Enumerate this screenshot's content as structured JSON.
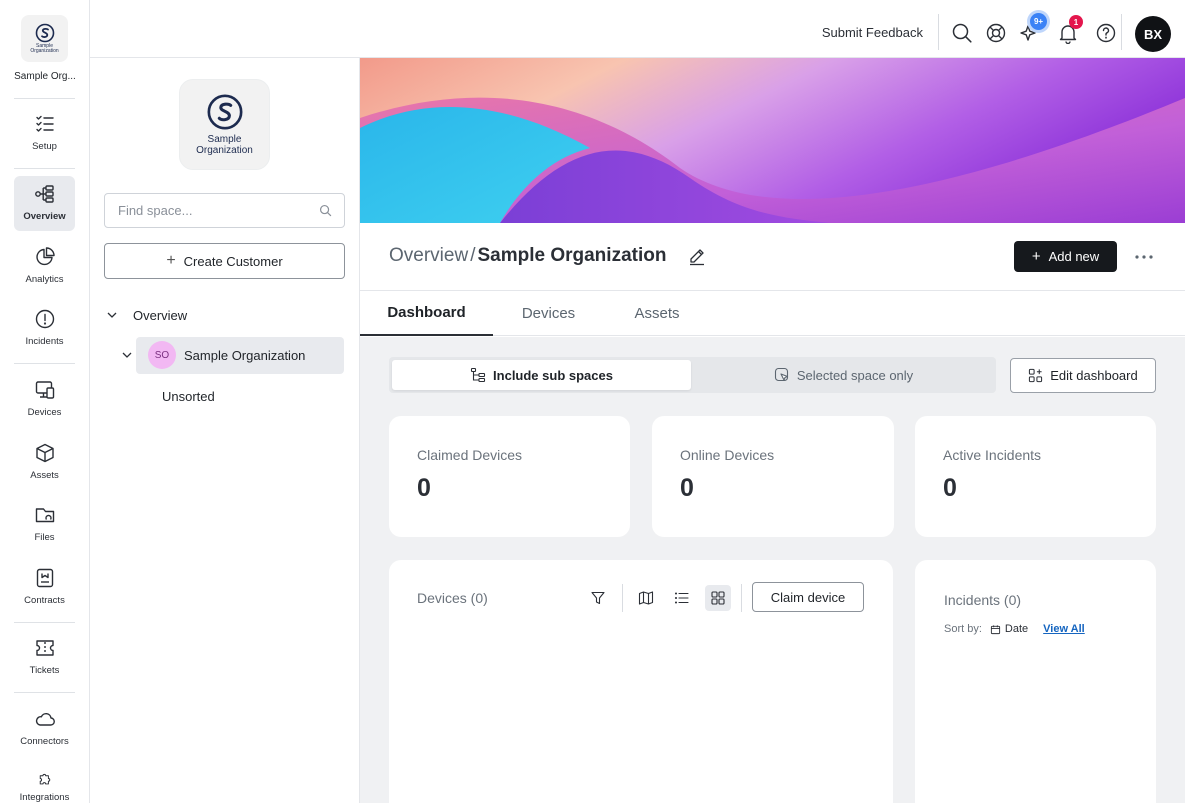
{
  "org": {
    "name_short": "Sample Org...",
    "logo_line1": "Sample",
    "logo_line2": "Organization"
  },
  "rail": {
    "items": [
      {
        "label": "Setup",
        "icon": "checklist-icon"
      },
      {
        "label": "Overview",
        "icon": "hierarchy-icon"
      },
      {
        "label": "Analytics",
        "icon": "pie-chart-icon"
      },
      {
        "label": "Incidents",
        "icon": "alert-circle-icon"
      },
      {
        "label": "Devices",
        "icon": "devices-icon"
      },
      {
        "label": "Assets",
        "icon": "cube-icon"
      },
      {
        "label": "Files",
        "icon": "folder-icon"
      },
      {
        "label": "Contracts",
        "icon": "contract-icon"
      },
      {
        "label": "Tickets",
        "icon": "ticket-icon"
      },
      {
        "label": "Connectors",
        "icon": "cloud-icon"
      },
      {
        "label": "Integrations",
        "icon": "puzzle-icon"
      }
    ],
    "active": "Overview"
  },
  "topbar": {
    "feedback": "Submit Feedback",
    "ai_badge": "9+",
    "notif_badge": "1",
    "user_initials": "BX"
  },
  "space_panel": {
    "search_placeholder": "Find space...",
    "create_label": "Create Customer",
    "tree": {
      "root": "Overview",
      "org_initials": "SO",
      "org": "Sample Organization",
      "child": "Unsorted"
    }
  },
  "main": {
    "breadcrumb_root": "Overview",
    "separator": "/",
    "current": "Sample Organization",
    "add_new": "Add new",
    "tabs": [
      "Dashboard",
      "Devices",
      "Assets"
    ],
    "active_tab": "Dashboard",
    "scope": {
      "include": "Include sub spaces",
      "selected": "Selected space only"
    },
    "edit_dashboard": "Edit dashboard",
    "stats": [
      {
        "label": "Claimed Devices",
        "value": "0"
      },
      {
        "label": "Online Devices",
        "value": "0"
      },
      {
        "label": "Active Incidents",
        "value": "0"
      }
    ],
    "devices_widget": {
      "title": "Devices (0)",
      "claim": "Claim device"
    },
    "incidents_widget": {
      "title": "Incidents (0)",
      "sort_label": "Sort by:",
      "sort_value": "Date",
      "view_all": "View All"
    }
  },
  "colors": {
    "accent_dark": "#16191d",
    "badge_red": "#e4164d",
    "badge_blue": "#3b82f6",
    "link": "#1565c0"
  }
}
